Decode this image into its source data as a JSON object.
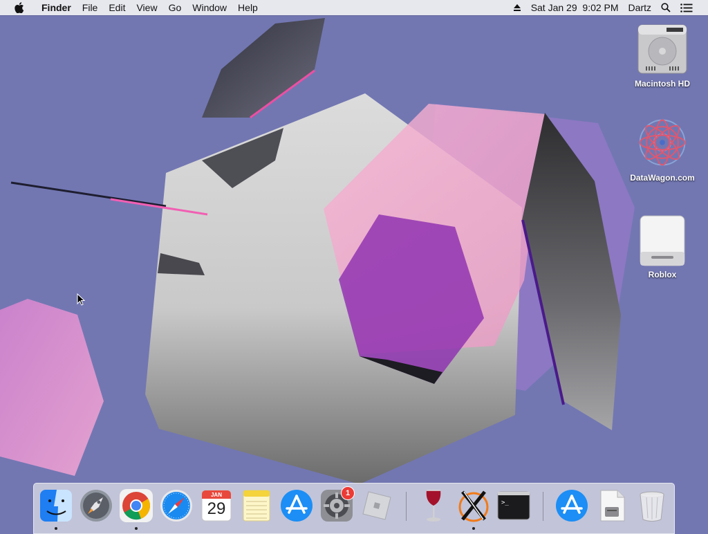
{
  "menubar": {
    "app_name": "Finder",
    "menus": [
      "File",
      "Edit",
      "View",
      "Go",
      "Window",
      "Help"
    ],
    "clock": "Sat Jan 29  9:02 PM",
    "user": "Dartz"
  },
  "desktop_icons": [
    {
      "label": "Macintosh HD",
      "icon": "hard-drive-icon"
    },
    {
      "label": "DataWagon.com",
      "icon": "mandala-image-icon"
    },
    {
      "label": "Roblox",
      "icon": "external-drive-icon"
    }
  ],
  "dock": {
    "calendar_month": "JAN",
    "calendar_day": "29",
    "system_prefs_badge": "1",
    "items": [
      {
        "name": "Finder",
        "icon": "finder-icon",
        "running": true
      },
      {
        "name": "Launchpad",
        "icon": "launchpad-icon",
        "running": false
      },
      {
        "name": "Google Chrome",
        "icon": "chrome-icon",
        "running": true
      },
      {
        "name": "Safari",
        "icon": "safari-icon",
        "running": false
      },
      {
        "name": "Calendar",
        "icon": "calendar-icon",
        "running": false
      },
      {
        "name": "Notes",
        "icon": "notes-icon",
        "running": false
      },
      {
        "name": "App Store",
        "icon": "app-store-icon",
        "running": false
      },
      {
        "name": "System Preferences",
        "icon": "gear-icon",
        "running": false
      },
      {
        "name": "Roblox",
        "icon": "roblox-icon",
        "running": false
      },
      {
        "name": "Wine",
        "icon": "wine-glass-icon",
        "running": false
      },
      {
        "name": "XQuartz",
        "icon": "xquartz-icon",
        "running": true
      },
      {
        "name": "Terminal",
        "icon": "terminal-icon",
        "running": false
      },
      {
        "name": "App Store Downloads",
        "icon": "downloads-stack-icon",
        "running": false
      },
      {
        "name": "Documents",
        "icon": "document-stack-icon",
        "running": false
      },
      {
        "name": "Trash",
        "icon": "trash-icon",
        "running": false
      }
    ]
  },
  "colors": {
    "desktop_bg": "#7277b2",
    "menubar_bg": "#ececf0",
    "accent_pink": "#f4a8cf",
    "accent_purple": "#9b3bb5"
  }
}
